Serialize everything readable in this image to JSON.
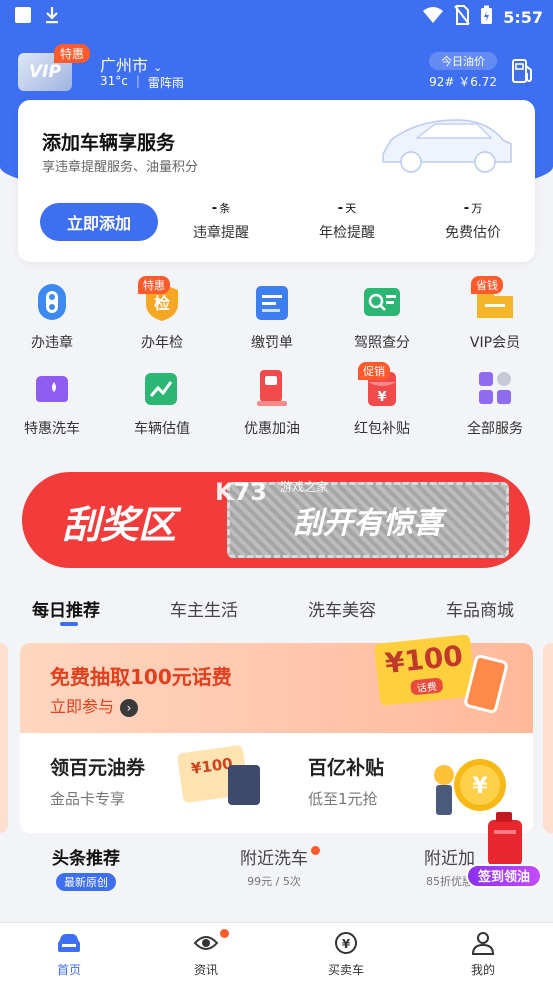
{
  "status_bar": {
    "time": "5:57"
  },
  "header": {
    "vip_text": "VIP",
    "vip_badge": "特惠",
    "city": "广州市",
    "temperature": "31°c",
    "weather": "雷阵雨",
    "oil_title": "今日油价",
    "oil_price": "92# ￥6.72"
  },
  "service_card": {
    "title": "添加车辆享服务",
    "subtitle": "享违章提醒服务、油量积分",
    "add_button": "立即添加",
    "stats": [
      {
        "value": "-",
        "unit": "条",
        "label": "违章提醒"
      },
      {
        "value": "-",
        "unit": "天",
        "label": "年检提醒"
      },
      {
        "value": "-",
        "unit": "万",
        "label": "免费估价"
      }
    ]
  },
  "grid": [
    {
      "label": "办违章",
      "icon": "violation-icon",
      "color": "#3d8bf0",
      "badge": ""
    },
    {
      "label": "办年检",
      "icon": "inspection-icon",
      "color": "#f5a623",
      "badge": "特惠"
    },
    {
      "label": "缴罚单",
      "icon": "ticket-icon",
      "color": "#3d7ff0",
      "badge": ""
    },
    {
      "label": "驾照查分",
      "icon": "license-icon",
      "color": "#2bb673",
      "badge": ""
    },
    {
      "label": "VIP会员",
      "icon": "vip-folder-icon",
      "color": "#f5b52a",
      "badge": "省钱"
    },
    {
      "label": "特惠洗车",
      "icon": "car-wash-icon",
      "color": "#8f5cf0",
      "badge": ""
    },
    {
      "label": "车辆估值",
      "icon": "valuation-icon",
      "color": "#2bb673",
      "badge": ""
    },
    {
      "label": "优惠加油",
      "icon": "fuel-icon",
      "color": "#f04a4a",
      "badge": ""
    },
    {
      "label": "红包补贴",
      "icon": "red-packet-icon",
      "color": "#f04a4a",
      "badge": "促销"
    },
    {
      "label": "全部服务",
      "icon": "all-services-icon",
      "color": "#8f6cf0",
      "badge": ""
    }
  ],
  "scratch_banner": {
    "left": "刮奖区",
    "right": "刮开有惊喜"
  },
  "watermark": {
    "main": "K73",
    "sub": "游戏之家"
  },
  "tabs": [
    "每日推荐",
    "车主生活",
    "洗车美容",
    "车品商城"
  ],
  "promo": {
    "title": "免费抽取100元话费",
    "cta": "立即参与",
    "ticket_value": "¥100",
    "ticket_tag": "话费"
  },
  "sub_promos": [
    {
      "title": "领百元油券",
      "subtitle": "金品卡专享",
      "coupon": "¥100"
    },
    {
      "title": "百亿补贴",
      "subtitle": "低至1元抢"
    }
  ],
  "feed_tabs": [
    {
      "title": "头条推荐",
      "sub": "最新原创"
    },
    {
      "title": "附近洗车",
      "sub": "99元 / 5次"
    },
    {
      "title": "附近加",
      "sub": "85折优惠"
    }
  ],
  "floating": {
    "label": "签到领油"
  },
  "bottom_nav": [
    {
      "label": "首页",
      "icon": "home-car-icon"
    },
    {
      "label": "资讯",
      "icon": "eye-icon"
    },
    {
      "label": "买卖车",
      "icon": "yuan-exchange-icon"
    },
    {
      "label": "我的",
      "icon": "user-icon"
    }
  ],
  "colors": {
    "brand": "#3d6ff0",
    "accent": "#ff5a2b"
  }
}
